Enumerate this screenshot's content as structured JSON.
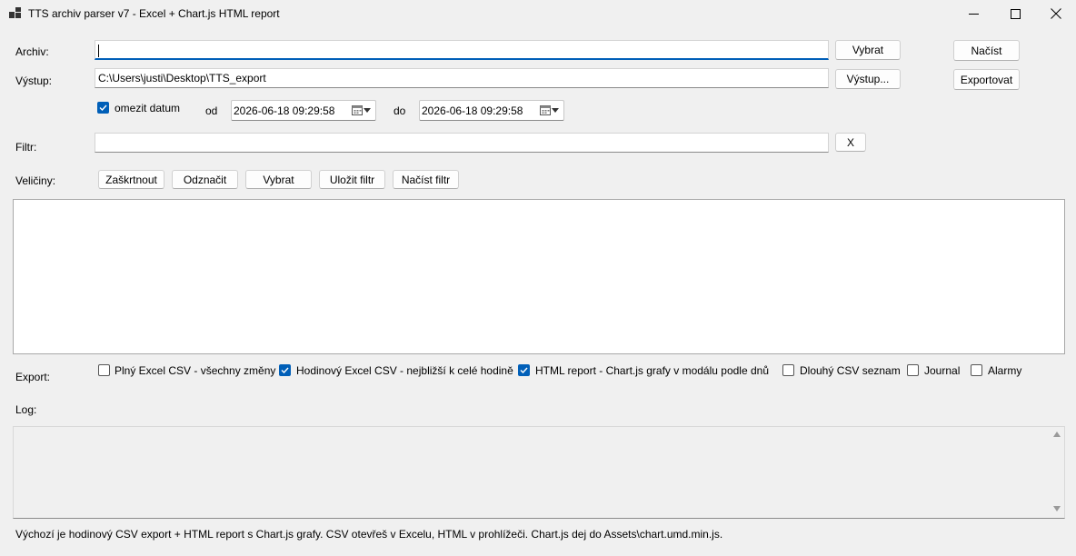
{
  "window": {
    "title": "TTS archiv parser v7 - Excel + Chart.js HTML report"
  },
  "archiv": {
    "label": "Archiv:",
    "value": "",
    "browse_label": "Vybrat",
    "load_label": "Načíst"
  },
  "vystup": {
    "label": "Výstup:",
    "value": "C:\\Users\\justi\\Desktop\\TTS_export",
    "browse_label": "Výstup...",
    "export_label": "Exportovat"
  },
  "date": {
    "limit_label": "omezit datum",
    "limit_checked": true,
    "from_label": "od",
    "from_value": "2026-06-18 09:29:58",
    "to_label": "do",
    "to_value": "2026-06-18 09:29:58"
  },
  "filter": {
    "label": "Filtr:",
    "value": "",
    "clear_label": "X"
  },
  "quantities": {
    "label": "Veličiny:",
    "check_label": "Zaškrtnout",
    "uncheck_label": "Odznačit",
    "select_label": "Vybrat",
    "save_filter_label": "Uložit filtr",
    "load_filter_label": "Načíst filtr"
  },
  "export": {
    "label": "Export:",
    "options": [
      {
        "label": "Plný Excel CSV - všechny změny",
        "checked": false
      },
      {
        "label": "Hodinový Excel CSV - nejbližší k celé hodině",
        "checked": true
      },
      {
        "label": "HTML report - Chart.js grafy v modálu podle dnů",
        "checked": true
      },
      {
        "label": "Dlouhý CSV seznam",
        "checked": false
      },
      {
        "label": "Journal",
        "checked": false
      },
      {
        "label": "Alarmy",
        "checked": false
      }
    ]
  },
  "log": {
    "label": "Log:",
    "content": ""
  },
  "status": {
    "text": "Výchozí je hodinový CSV export + HTML report s Chart.js grafy. CSV otevřeš v Excelu, HTML v prohlížeči. Chart.js dej do Assets\\chart.umd.min.js."
  },
  "colors": {
    "accent": "#005fb8",
    "background": "#f0f0f0"
  }
}
